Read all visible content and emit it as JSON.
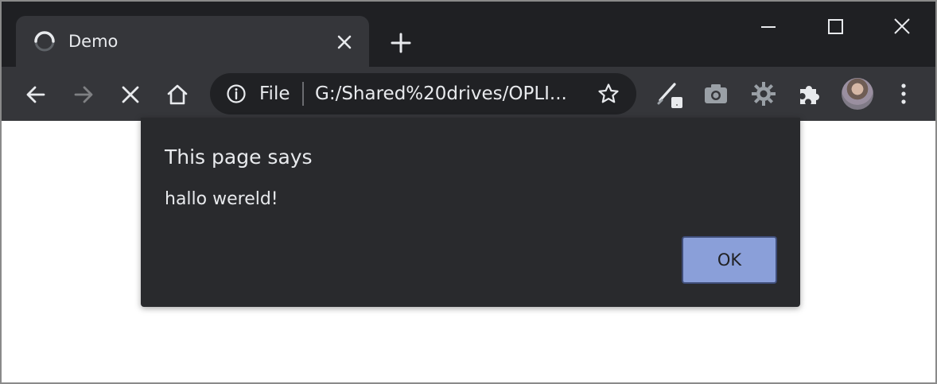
{
  "tab": {
    "title": "Demo"
  },
  "omnibox": {
    "scheme_label": "File",
    "url": "G:/Shared%20drives/OPLI..."
  },
  "dialog": {
    "title": "This page says",
    "message": "hallo wereld!",
    "ok_label": "OK"
  },
  "icons": {
    "favicon": "loading-spinner-icon",
    "tab_close": "close-icon",
    "new_tab": "plus-icon",
    "back": "arrow-left-icon",
    "forward": "arrow-right-icon",
    "stop": "close-icon",
    "home": "home-icon",
    "info": "info-icon",
    "bookmark": "star-icon",
    "extensions": [
      "pen-icon",
      "camera-icon",
      "gear-icon",
      "puzzle-icon"
    ],
    "menu": "kebab-menu-icon"
  },
  "colors": {
    "tabstrip_bg": "#1f2023",
    "toolbar_bg": "#35363a",
    "dialog_bg": "#292a2d",
    "ok_button": "#8a9fd9"
  }
}
